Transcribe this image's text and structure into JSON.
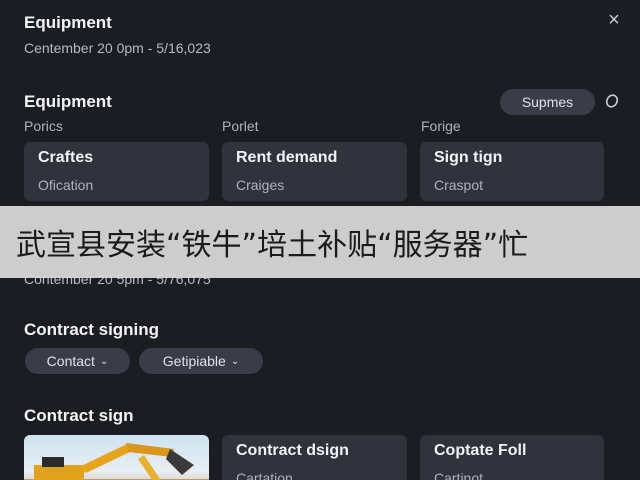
{
  "header": {
    "title": "Equipment",
    "date_line": "Centember 20 0pm - 5/16,023",
    "close_icon": "×"
  },
  "equipment": {
    "title": "Equipment",
    "supplies_button": "Supmes",
    "columns": [
      "Porics",
      "Porlet",
      "Forige"
    ],
    "cards": [
      {
        "title": "Craftes",
        "subtitle": "Ofication"
      },
      {
        "title": "Rent demand",
        "subtitle": "Craiges"
      },
      {
        "title": "Sign tign",
        "subtitle": "Craspot"
      }
    ]
  },
  "banner": {
    "text": "武宣县安装“铁牛”培土补贴“服务器”忙"
  },
  "second": {
    "date_line": "Contember 20 5pm - 5/76,075"
  },
  "contract_signing": {
    "title": "Contract signing",
    "contact_dropdown": "Contact",
    "getipiable_dropdown": "Getipiable"
  },
  "contract_sign": {
    "title": "Contract sign",
    "cards": [
      {
        "title": "Contract dsign",
        "subtitle": "Cartation"
      },
      {
        "title": "Coptate Foll",
        "subtitle": "Cartinot"
      }
    ]
  }
}
